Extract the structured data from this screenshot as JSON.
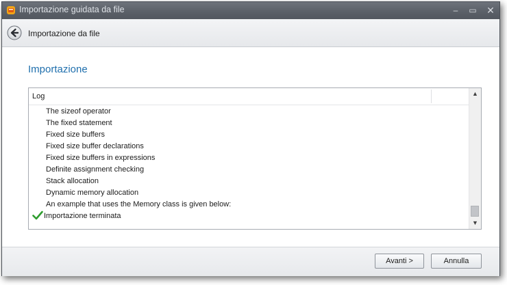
{
  "window": {
    "title": "Importazione guidata da file",
    "controls": {
      "minimize": "–",
      "maximize": "▭",
      "close": "✕"
    }
  },
  "navbar": {
    "title": "Importazione da file"
  },
  "main": {
    "section_title": "Importazione",
    "log": {
      "header": "Log",
      "lines": [
        "The sizeof operator",
        "The fixed statement",
        "Fixed size buffers",
        "Fixed size buffer declarations",
        "Fixed size buffers in expressions",
        "Definite assignment checking",
        "Stack allocation",
        "Dynamic memory allocation",
        "An example that uses the Memory class is given below:"
      ],
      "final_line": "Importazione terminata",
      "final_icon": "check-icon",
      "scroll_position": 0.97
    }
  },
  "footer": {
    "next_label": "Avanti >",
    "cancel_label": "Annulla"
  },
  "colors": {
    "accent": "#1f6fad",
    "titlebar": "#5a5f67",
    "check": "#2e9d2e"
  }
}
